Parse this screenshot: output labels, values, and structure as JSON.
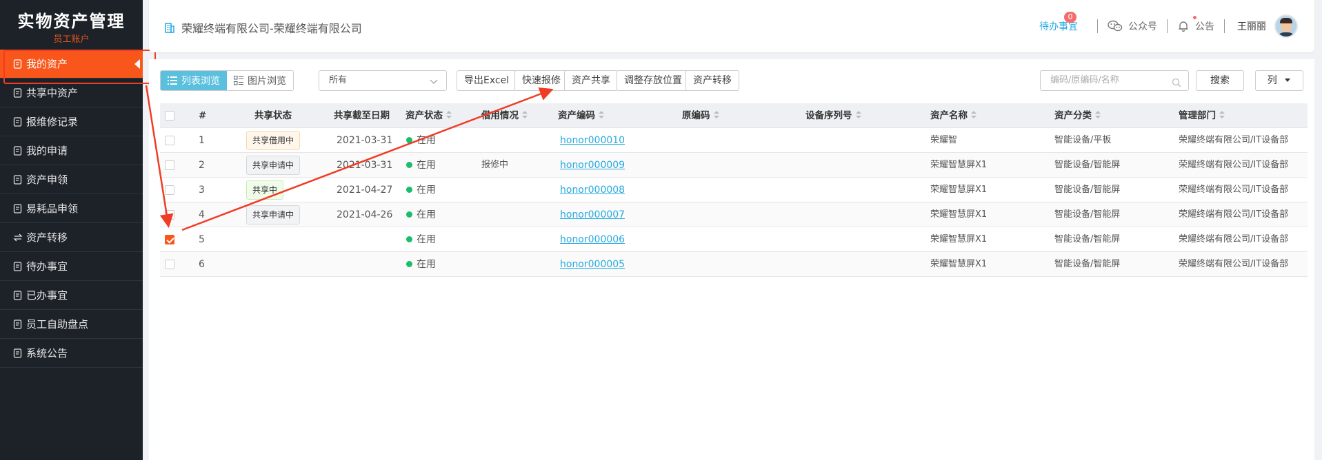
{
  "sidebar": {
    "title": "实物资产管理",
    "subtitle": "员工账户",
    "items": [
      {
        "label": "我的资产",
        "icon": "asset-icon",
        "active": true
      },
      {
        "label": "共享中资产",
        "icon": "share-doc-icon"
      },
      {
        "label": "报维修记录",
        "icon": "repair-record-icon"
      },
      {
        "label": "我的申请",
        "icon": "apply-icon"
      },
      {
        "label": "资产申领",
        "icon": "claim-icon"
      },
      {
        "label": "易耗品申领",
        "icon": "consumable-icon"
      },
      {
        "label": "资产转移",
        "icon": "transfer-icon"
      },
      {
        "label": "待办事宜",
        "icon": "todo-icon"
      },
      {
        "label": "已办事宜",
        "icon": "done-icon"
      },
      {
        "label": "员工自助盘点",
        "icon": "inventory-icon"
      },
      {
        "label": "系统公告",
        "icon": "notice-icon"
      }
    ]
  },
  "header": {
    "company": "荣耀终端有限公司-荣耀终端有限公司",
    "todo_label": "待办事宜",
    "todo_count": "0",
    "wechat_label": "公众号",
    "notice_label": "公告",
    "username": "王丽丽"
  },
  "toolbar": {
    "list_view": "列表浏览",
    "image_view": "图片浏览",
    "filter_value": "所有",
    "export": "导出Excel",
    "quick_repair": "快速报修",
    "share": "资产共享",
    "adjust_location": "调整存放位置",
    "transfer": "资产转移",
    "search_placeholder": "编码/原编码/名称",
    "search_btn": "搜索",
    "columns_btn": "列"
  },
  "table": {
    "headers": {
      "num": "#",
      "share_status": "共享状态",
      "share_end": "共享截至日期",
      "asset_status": "资产状态",
      "borrow": "借用情况",
      "code": "资产编码",
      "orig_code": "原编码",
      "serial": "设备序列号",
      "name": "资产名称",
      "category": "资产分类",
      "dept": "管理部门"
    },
    "rows": [
      {
        "num": "1",
        "share_status": "共享借用中",
        "share_type": "borrow",
        "share_end": "2021-03-31",
        "asset_status": "在用",
        "borrow": "",
        "code": "honor000010",
        "name": "荣耀智",
        "category": "智能设备/平板",
        "dept": "荣耀终端有限公司/IT设备部",
        "checked": false
      },
      {
        "num": "2",
        "share_status": "共享申请中",
        "share_type": "apply",
        "share_end": "2021-03-31",
        "asset_status": "在用",
        "borrow": "报修中",
        "code": "honor000009",
        "name": "荣耀智慧屏X1",
        "category": "智能设备/智能屏",
        "dept": "荣耀终端有限公司/IT设备部",
        "checked": false
      },
      {
        "num": "3",
        "share_status": "共享中",
        "share_type": "sharing",
        "share_end": "2021-04-27",
        "asset_status": "在用",
        "borrow": "",
        "code": "honor000008",
        "name": "荣耀智慧屏X1",
        "category": "智能设备/智能屏",
        "dept": "荣耀终端有限公司/IT设备部",
        "checked": false
      },
      {
        "num": "4",
        "share_status": "共享申请中",
        "share_type": "apply",
        "share_end": "2021-04-26",
        "asset_status": "在用",
        "borrow": "",
        "code": "honor000007",
        "name": "荣耀智慧屏X1",
        "category": "智能设备/智能屏",
        "dept": "荣耀终端有限公司/IT设备部",
        "checked": false
      },
      {
        "num": "5",
        "share_status": "",
        "share_type": "",
        "share_end": "",
        "asset_status": "在用",
        "borrow": "",
        "code": "honor000006",
        "name": "荣耀智慧屏X1",
        "category": "智能设备/智能屏",
        "dept": "荣耀终端有限公司/IT设备部",
        "checked": true
      },
      {
        "num": "6",
        "share_status": "",
        "share_type": "",
        "share_end": "",
        "asset_status": "在用",
        "borrow": "",
        "code": "honor000005",
        "name": "荣耀智慧屏X1",
        "category": "智能设备/智能屏",
        "dept": "荣耀终端有限公司/IT设备部",
        "checked": false
      }
    ]
  },
  "colors": {
    "accent": "#f9561b",
    "sidebar_bg": "#1d2229",
    "link": "#26a9e0",
    "status_green": "#19be6b",
    "annotation_red": "#f03c24"
  }
}
